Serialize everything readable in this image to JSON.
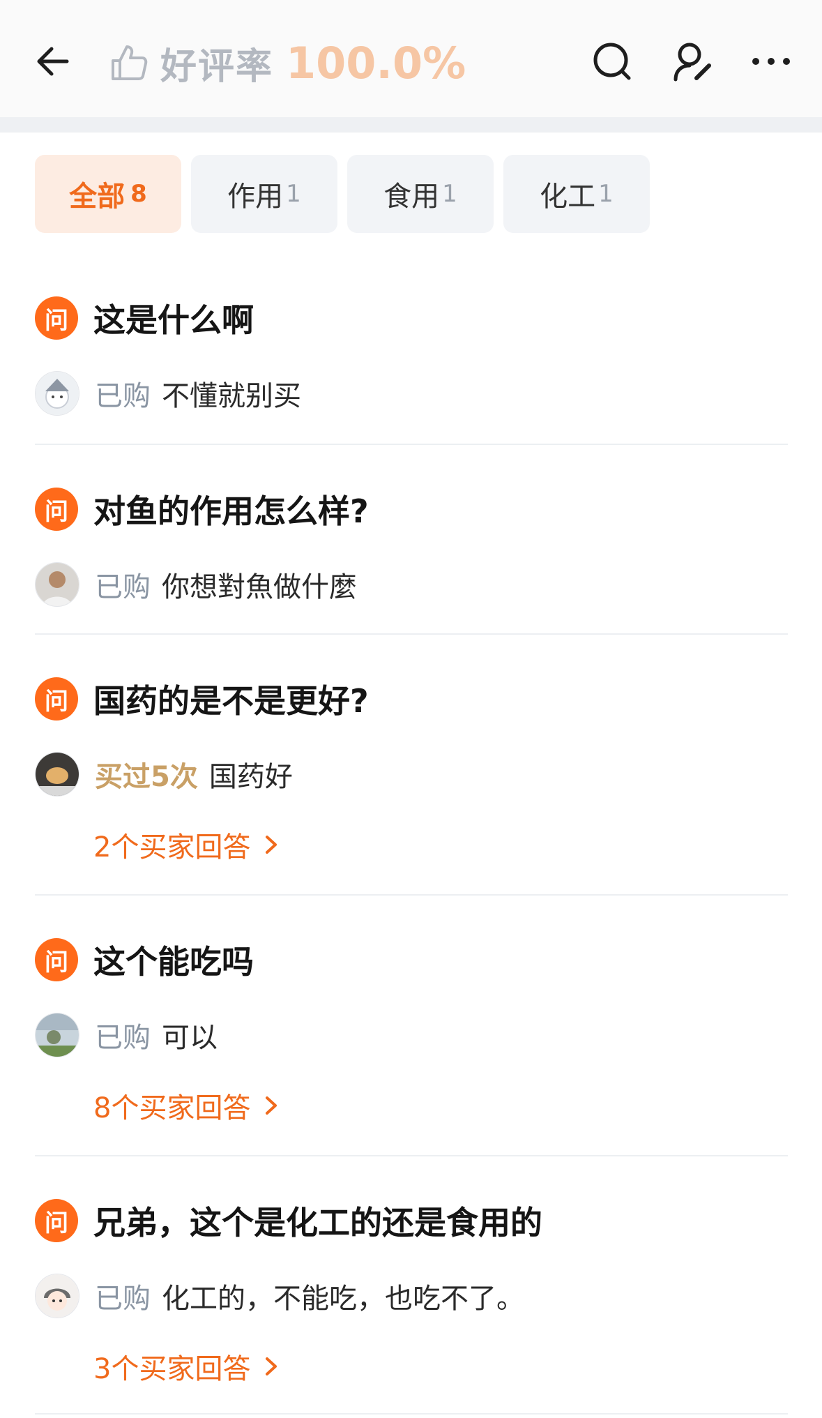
{
  "header": {
    "rating_label": "好评率",
    "rating_value": "100.0%",
    "icons": [
      "back-arrow-icon",
      "thumbs-up-icon",
      "search-icon",
      "profile-edit-icon",
      "more-icon"
    ]
  },
  "tabs": [
    {
      "label": "全部",
      "count": "8",
      "active": true
    },
    {
      "label": "作用",
      "count": "1",
      "active": false
    },
    {
      "label": "食用",
      "count": "1",
      "active": false
    },
    {
      "label": "化工",
      "count": "1",
      "active": false
    }
  ],
  "questions": [
    {
      "badge": "问",
      "question": "这是什么啊",
      "answer_tag": "已购",
      "answer": "不懂就别买",
      "more": ""
    },
    {
      "badge": "问",
      "question": "对鱼的作用怎么样?",
      "answer_tag": "已购",
      "answer": "你想對魚做什麼",
      "more": ""
    },
    {
      "badge": "问",
      "question": "国药的是不是更好?",
      "answer_tag": "买过5次",
      "answer": "国药好",
      "more": "2个买家回答"
    },
    {
      "badge": "问",
      "question": "这个能吃吗",
      "answer_tag": "已购",
      "answer": "可以",
      "more": "8个买家回答"
    },
    {
      "badge": "问",
      "question": "兄弟，这个是化工的还是食用的",
      "answer_tag": "已购",
      "answer": "化工的，不能吃，也吃不了。",
      "more": "3个买家回答"
    }
  ],
  "colors": {
    "accent": "#ff6a1a",
    "rating_value": "#f6c6a4",
    "gold_tag": "#c9a066"
  }
}
